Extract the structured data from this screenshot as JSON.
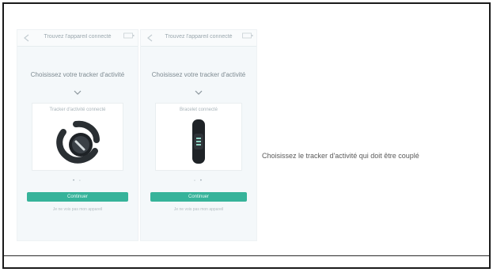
{
  "phones": [
    {
      "title": "Trouvez l'appareil connecté",
      "heading": "Choisissez votre tracker d'activité",
      "device_label": "Tracker d'activité connecté",
      "device_icon": "smartwatch-round-icon",
      "pager": "• ◦",
      "button_label": "Continuer",
      "link_text": "Je ne vois pas mon appareil"
    },
    {
      "title": "Trouvez l'appareil connecté",
      "heading": "Choisissez votre tracker d'activité",
      "device_label": "Bracelet connecté",
      "device_icon": "fitness-band-icon",
      "pager": "◦ •",
      "button_label": "Continuer",
      "link_text": "Je ne vois pas mon appareil"
    }
  ],
  "caption": "Choisissez le tracker d'activité qui doit être couplé",
  "colors": {
    "accent": "#36b39a",
    "screen_bg": "#f4f8fa",
    "caption_text": "#5a5a5a"
  }
}
